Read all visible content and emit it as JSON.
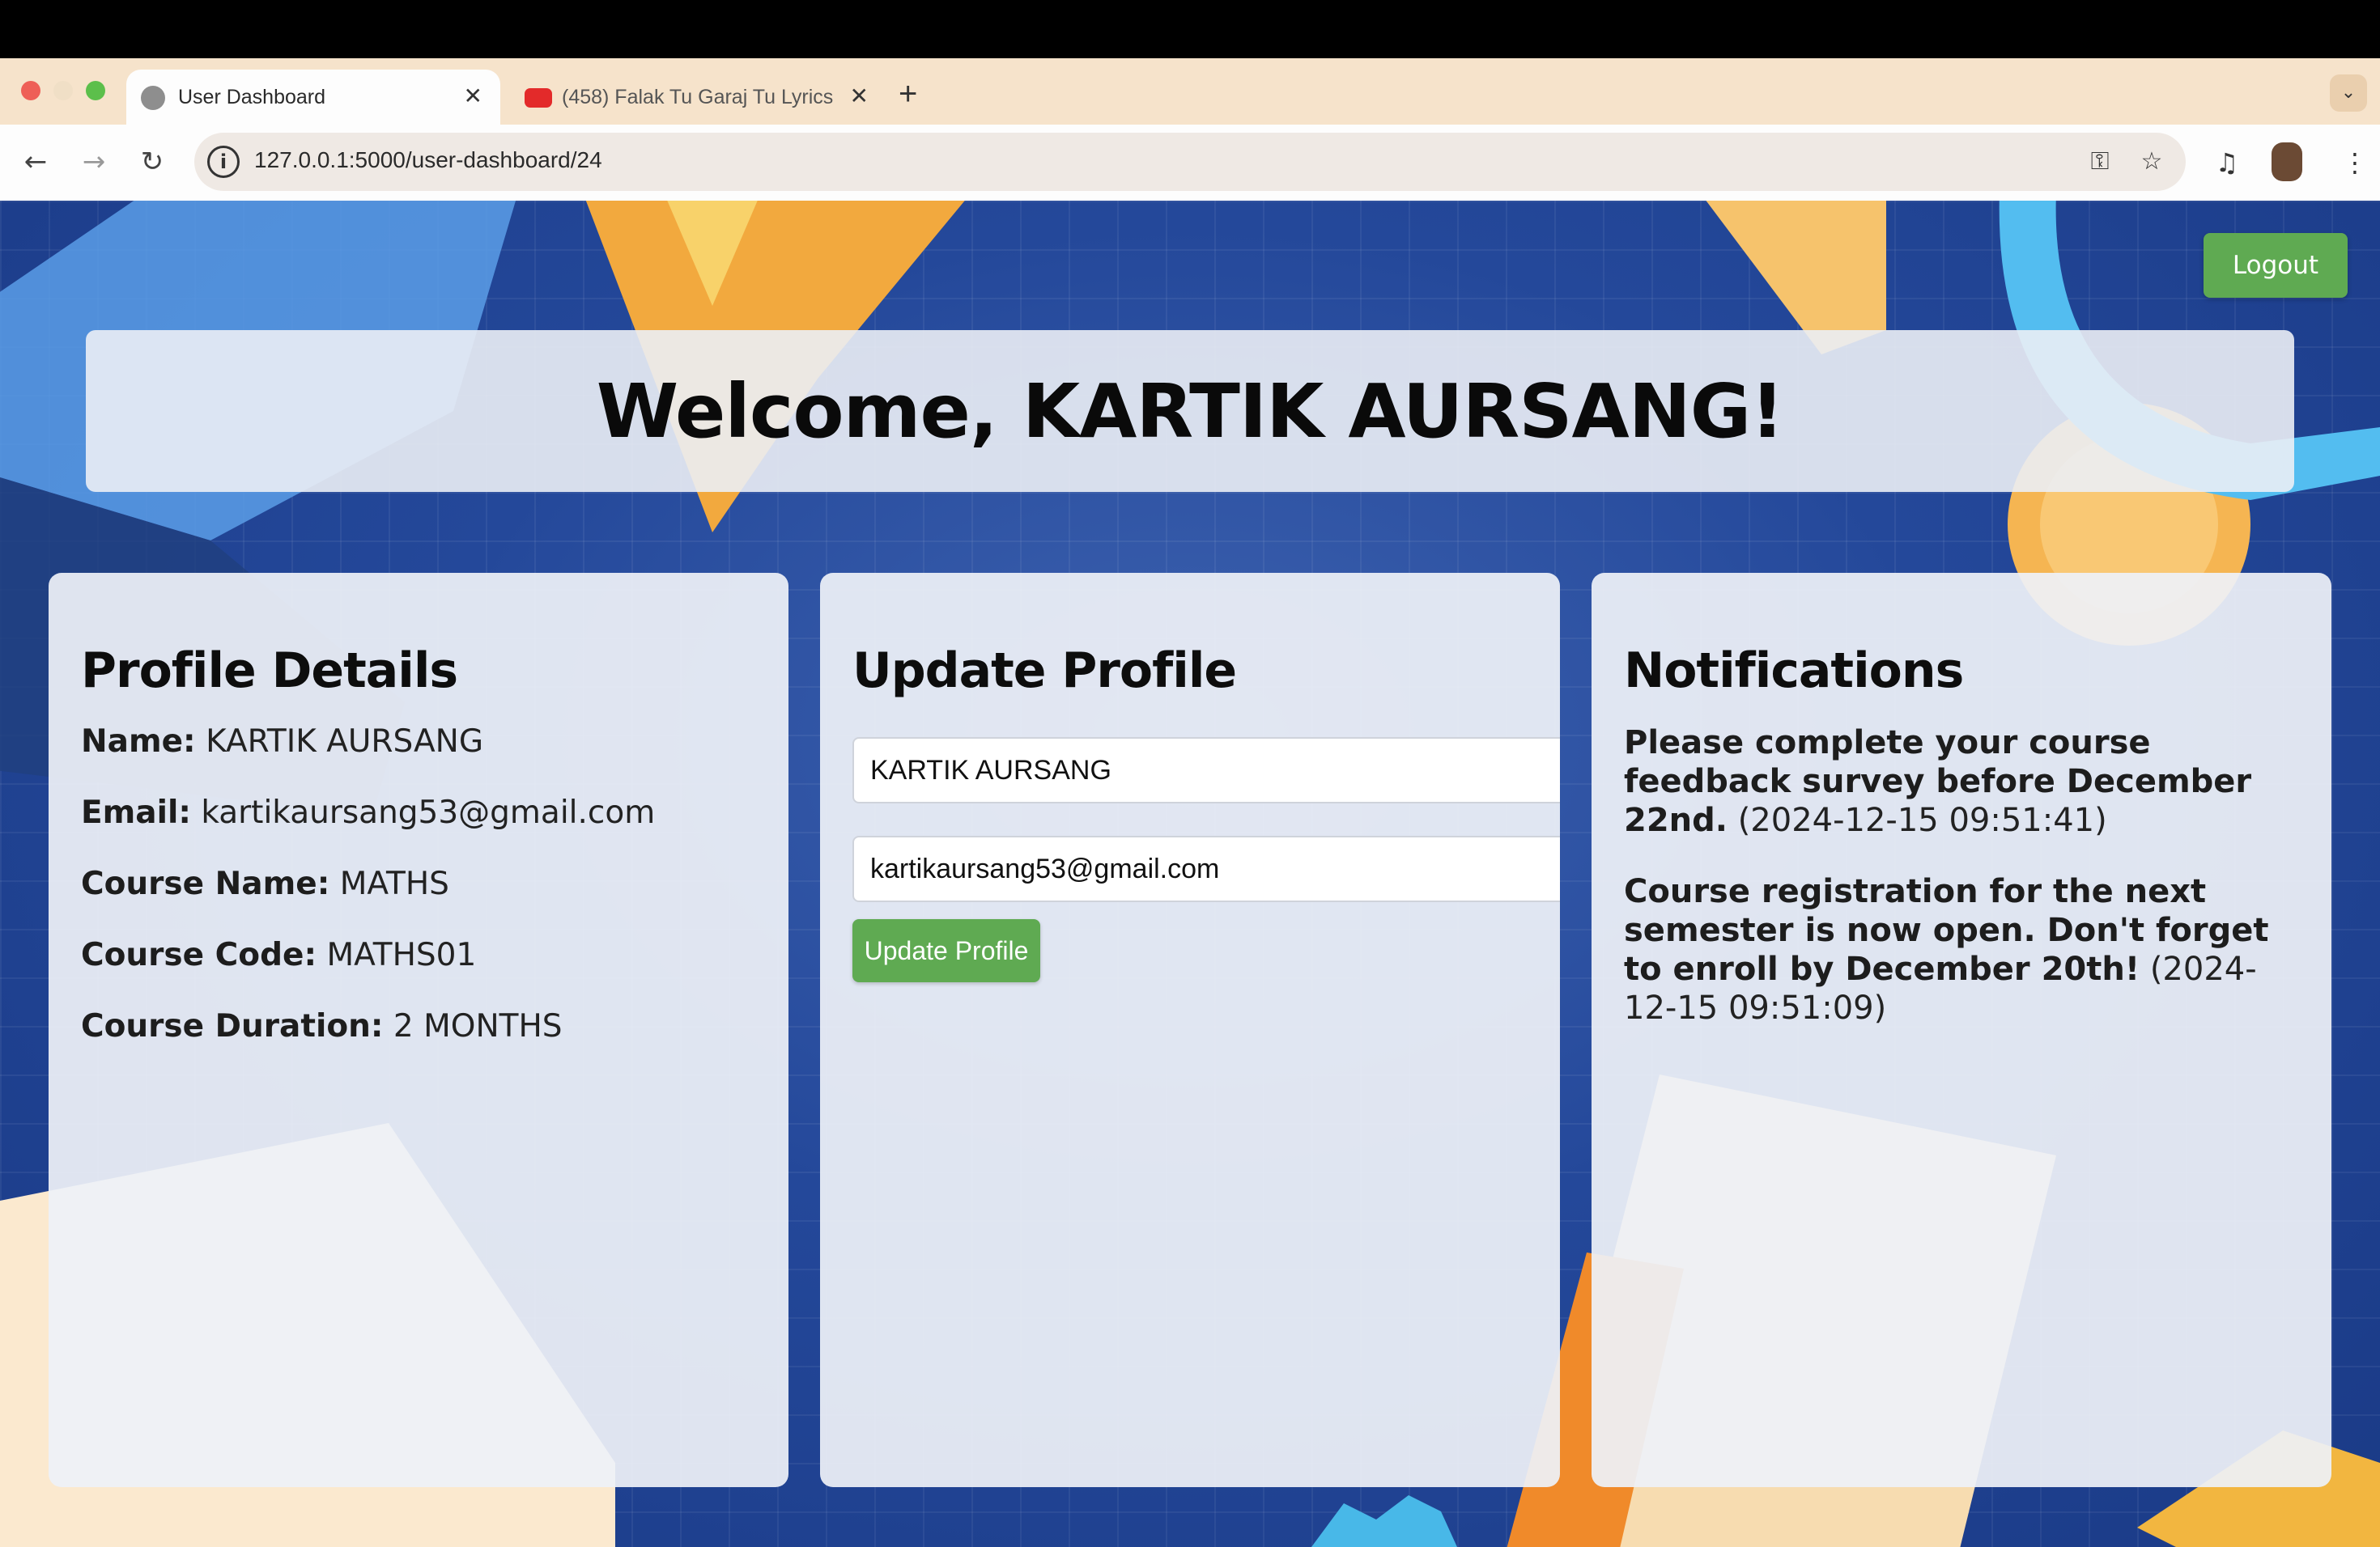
{
  "browser": {
    "tabs": [
      {
        "title": "User Dashboard",
        "active": true
      },
      {
        "title": "(458) Falak Tu Garaj Tu Lyrics",
        "active": false
      }
    ],
    "url": "127.0.0.1:5000/user-dashboard/24"
  },
  "page": {
    "logout_label": "Logout",
    "welcome": "Welcome, KARTIK AURSANG!"
  },
  "profile": {
    "heading": "Profile Details",
    "fields": [
      {
        "label": "Name:",
        "value": "KARTIK AURSANG"
      },
      {
        "label": "Email:",
        "value": "kartikaursang53@gmail.com"
      },
      {
        "label": "Course Name:",
        "value": "MATHS"
      },
      {
        "label": "Course Code:",
        "value": "MATHS01"
      },
      {
        "label": "Course Duration:",
        "value": "2 MONTHS"
      }
    ]
  },
  "update": {
    "heading": "Update Profile",
    "name_value": "KARTIK AURSANG",
    "email_value": "kartikaursang53@gmail.com",
    "button_label": "Update Profile"
  },
  "notifications": {
    "heading": "Notifications",
    "items": [
      {
        "message": "Please complete your course feedback survey before December 22nd.",
        "timestamp": "(2024-12-15 09:51:41)"
      },
      {
        "message": "Course registration for the next semester is now open. Don't forget to enroll by December 20th!",
        "timestamp": "(2024-12-15 09:51:09)"
      }
    ]
  },
  "colors": {
    "accent_green": "#5faa52",
    "background_blue": "#24489a",
    "chrome_beige": "#f6e3cb"
  }
}
